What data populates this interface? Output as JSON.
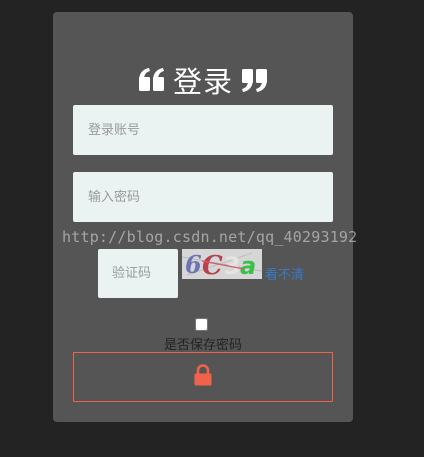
{
  "login": {
    "title": "登录",
    "account_placeholder": "登录账号",
    "password_placeholder": "输入密码",
    "captcha_placeholder": "验证码",
    "captcha_text": "6C3a",
    "refresh_link": "看不清",
    "remember_label": "是否保存密码",
    "remember_checked": false,
    "submit_icon": "lock-icon"
  },
  "watermark": {
    "text": "http://blog.csdn.net/qq_40293192"
  },
  "colors": {
    "page_bg": "#232323",
    "card_bg": "#555555",
    "field_bg": "#eaf3f2",
    "accent": "#f2624a",
    "link": "#3a79c7"
  }
}
